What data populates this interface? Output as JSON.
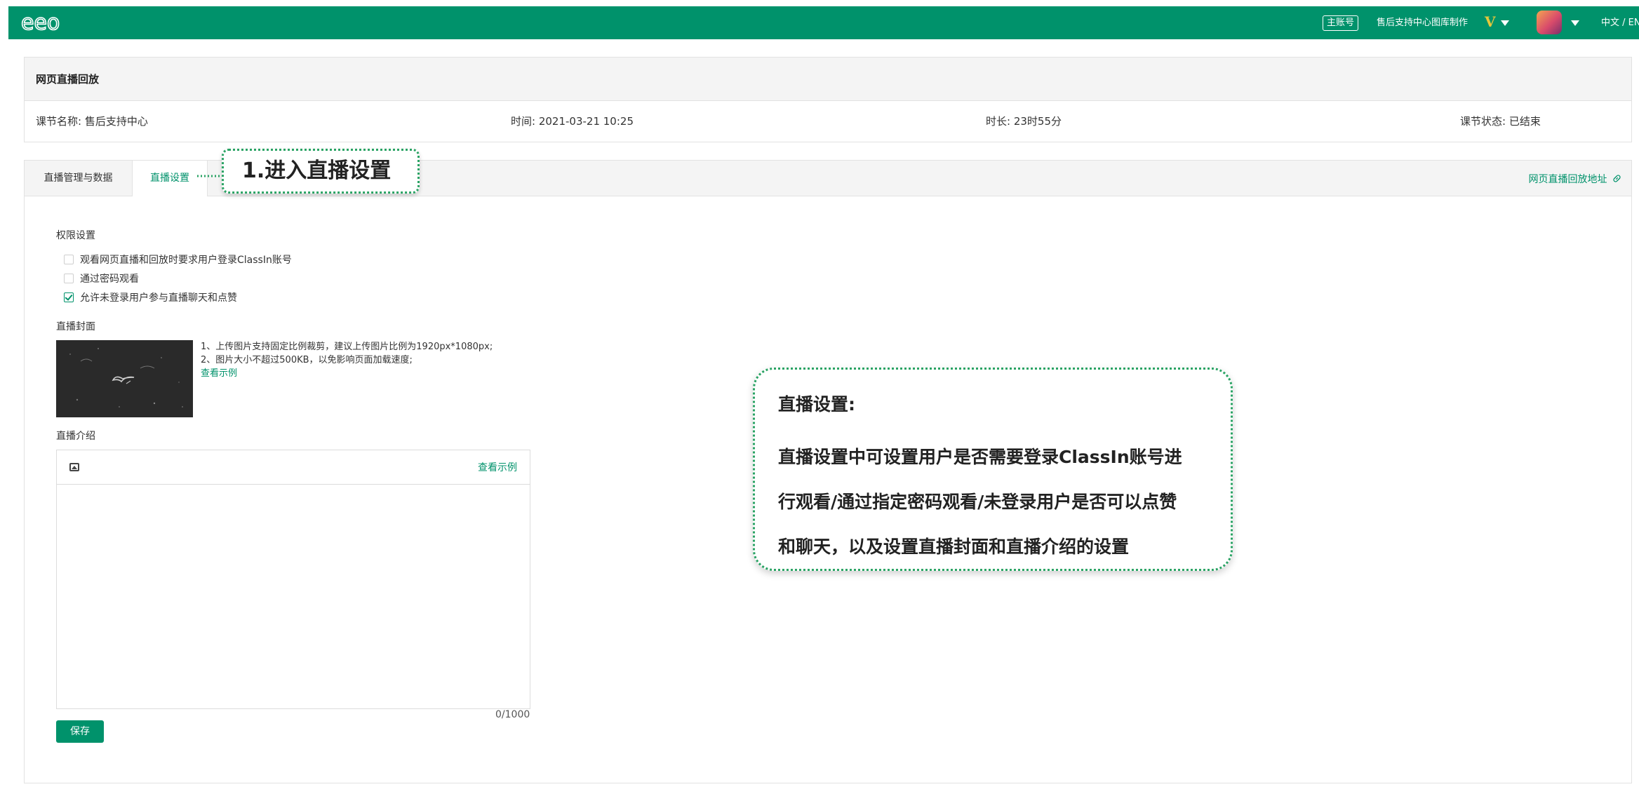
{
  "topbar": {
    "logo_text": "eeo",
    "account_badge": "主账号",
    "account_name": "售后支持中心图库制作",
    "vip_badge": "V",
    "language": "中文 / EN"
  },
  "header": {
    "title": "网页直播回放",
    "course_name": "课节名称: 售后支持中心",
    "time": "时间: 2021-03-21 10:25",
    "duration": "时长: 23时55分",
    "status": "课节状态:  已结束"
  },
  "tabs": [
    {
      "label": "直播管理与数据",
      "active": false
    },
    {
      "label": "直播设置",
      "active": true
    }
  ],
  "replay_link": "网页直播回放地址",
  "permissions": {
    "title": "权限设置",
    "options": [
      {
        "label": "观看网页直播和回放时要求用户登录ClassIn账号",
        "checked": false
      },
      {
        "label": "通过密码观看",
        "checked": false
      },
      {
        "label": "允许未登录用户参与直播聊天和点赞",
        "checked": true
      }
    ]
  },
  "cover": {
    "title": "直播封面",
    "note_line1": "1、上传图片支持固定比例裁剪，建议上传图片比例为1920px*1080px;",
    "note_line2": "2、图片大小不超过500KB，以免影响页面加载速度;",
    "example_link": "查看示例"
  },
  "intro": {
    "title": "直播介绍",
    "example_link": "查看示例",
    "counter": "0/1000",
    "value": ""
  },
  "save_label": "保存",
  "callouts": {
    "step1": "1.进入直播设置",
    "desc_title": "直播设置:",
    "desc_line1": "直播设置中可设置用户是否需要登录ClassIn账号进",
    "desc_line2": "行观看/通过指定密码观看/未登录用户是否可以点赞",
    "desc_line3": "和聊天，以及设置直播封面和直播介绍的设置"
  },
  "colors": {
    "brand": "#00926b",
    "callout_border": "#2aa364",
    "vip": "#e6c73a"
  }
}
